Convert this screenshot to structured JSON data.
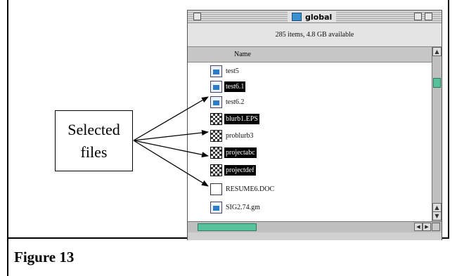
{
  "window": {
    "title": "global",
    "info": "285 items, 4.8 GB available",
    "column_header": "Name",
    "files": [
      {
        "name": "test5",
        "selected": false,
        "icon": "document-icon"
      },
      {
        "name": "test6.1",
        "selected": true,
        "icon": "document-icon"
      },
      {
        "name": "test6.2",
        "selected": false,
        "icon": "document-icon"
      },
      {
        "name": "blurb1.EPS",
        "selected": true,
        "icon": "program-icon"
      },
      {
        "name": "problurb3",
        "selected": false,
        "icon": "program-icon"
      },
      {
        "name": "projectabc",
        "selected": true,
        "icon": "program-icon"
      },
      {
        "name": "projectdef",
        "selected": true,
        "icon": "program-icon"
      },
      {
        "name": "RESUME6.DOC",
        "selected": false,
        "icon": "plain-document-icon"
      },
      {
        "name": "SIG2.74.gm",
        "selected": false,
        "icon": "application-icon"
      }
    ]
  },
  "callout": {
    "line1": "Selected",
    "line2": "files"
  },
  "caption": "Figure 13",
  "colors": {
    "selection": "#000000",
    "scroll_thumb": "#57c39b",
    "folder_icon": "#3a8fd0"
  }
}
